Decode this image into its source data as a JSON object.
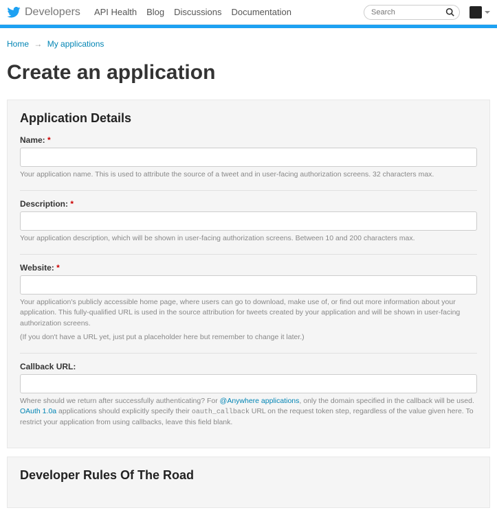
{
  "topbar": {
    "brand": "Developers",
    "nav": {
      "api_health": "API Health",
      "blog": "Blog",
      "discussions": "Discussions",
      "documentation": "Documentation"
    },
    "search_placeholder": "Search"
  },
  "breadcrumb": {
    "home": "Home",
    "my_apps": "My applications"
  },
  "page_title": "Create an application",
  "details": {
    "heading": "Application Details",
    "name_label": "Name:",
    "name_help": "Your application name. This is used to attribute the source of a tweet and in user-facing authorization screens. 32 characters max.",
    "desc_label": "Description:",
    "desc_help": "Your application description, which will be shown in user-facing authorization screens. Between 10 and 200 characters max.",
    "website_label": "Website:",
    "website_help_1": "Your application's publicly accessible home page, where users can go to download, make use of, or find out more information about your application. This fully-qualified URL is used in the source attribution for tweets created by your application and will be shown in user-facing authorization screens.",
    "website_help_2": "(If you don't have a URL yet, just put a placeholder here but remember to change it later.)",
    "callback_label": "Callback URL:",
    "callback_help_pre": "Where should we return after successfully authenticating? For ",
    "callback_link_anywhere": "@Anywhere applications",
    "callback_help_mid": ", only the domain specified in the callback will be used. ",
    "callback_link_oauth": "OAuth 1.0a",
    "callback_help_post": " applications should explicitly specify their ",
    "callback_code": "oauth_callback",
    "callback_help_end": " URL on the request token step, regardless of the value given here. To restrict your application from using callbacks, leave this field blank.",
    "required_mark": "*"
  },
  "rules": {
    "heading": "Developer Rules Of The Road"
  }
}
